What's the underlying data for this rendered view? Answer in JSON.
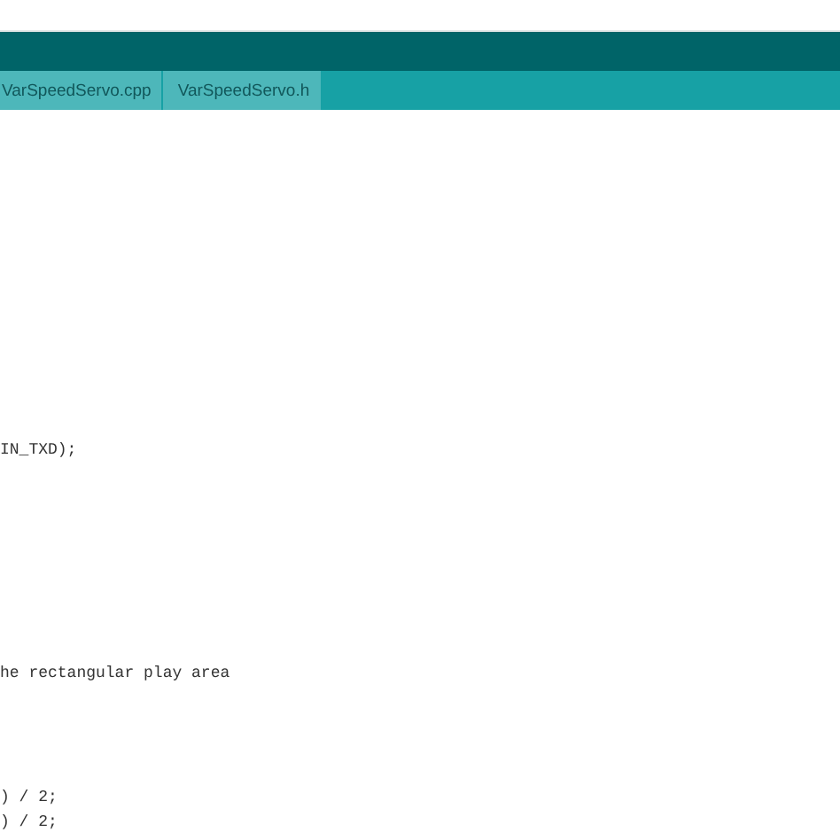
{
  "tabs": [
    {
      "label": "VarSpeedServo.cpp",
      "selected": false
    },
    {
      "label": "VarSpeedServo.h",
      "selected": false
    }
  ],
  "editor": {
    "lines": [
      {
        "kind": "blank"
      },
      {
        "kind": "blank"
      },
      {
        "kind": "blank"
      },
      {
        "kind": "blank"
      },
      {
        "kind": "blank"
      },
      {
        "kind": "blank"
      },
      {
        "kind": "blank"
      },
      {
        "kind": "blank"
      },
      {
        "kind": "blank"
      },
      {
        "kind": "blank"
      },
      {
        "kind": "blank"
      },
      {
        "kind": "blank"
      },
      {
        "kind": "blank"
      },
      {
        "kind": "code",
        "text": "IN_TXD);"
      },
      {
        "kind": "blank"
      },
      {
        "kind": "blank"
      },
      {
        "kind": "blank"
      },
      {
        "kind": "blank"
      },
      {
        "kind": "blank"
      },
      {
        "kind": "blank"
      },
      {
        "kind": "blank"
      },
      {
        "kind": "blank"
      },
      {
        "kind": "code",
        "text": "he rectangular play area"
      },
      {
        "kind": "blank"
      },
      {
        "kind": "blank"
      },
      {
        "kind": "blank"
      },
      {
        "kind": "blank"
      },
      {
        "kind": "code",
        "text": ") / 2;"
      },
      {
        "kind": "code",
        "text": ") / 2;"
      }
    ]
  }
}
